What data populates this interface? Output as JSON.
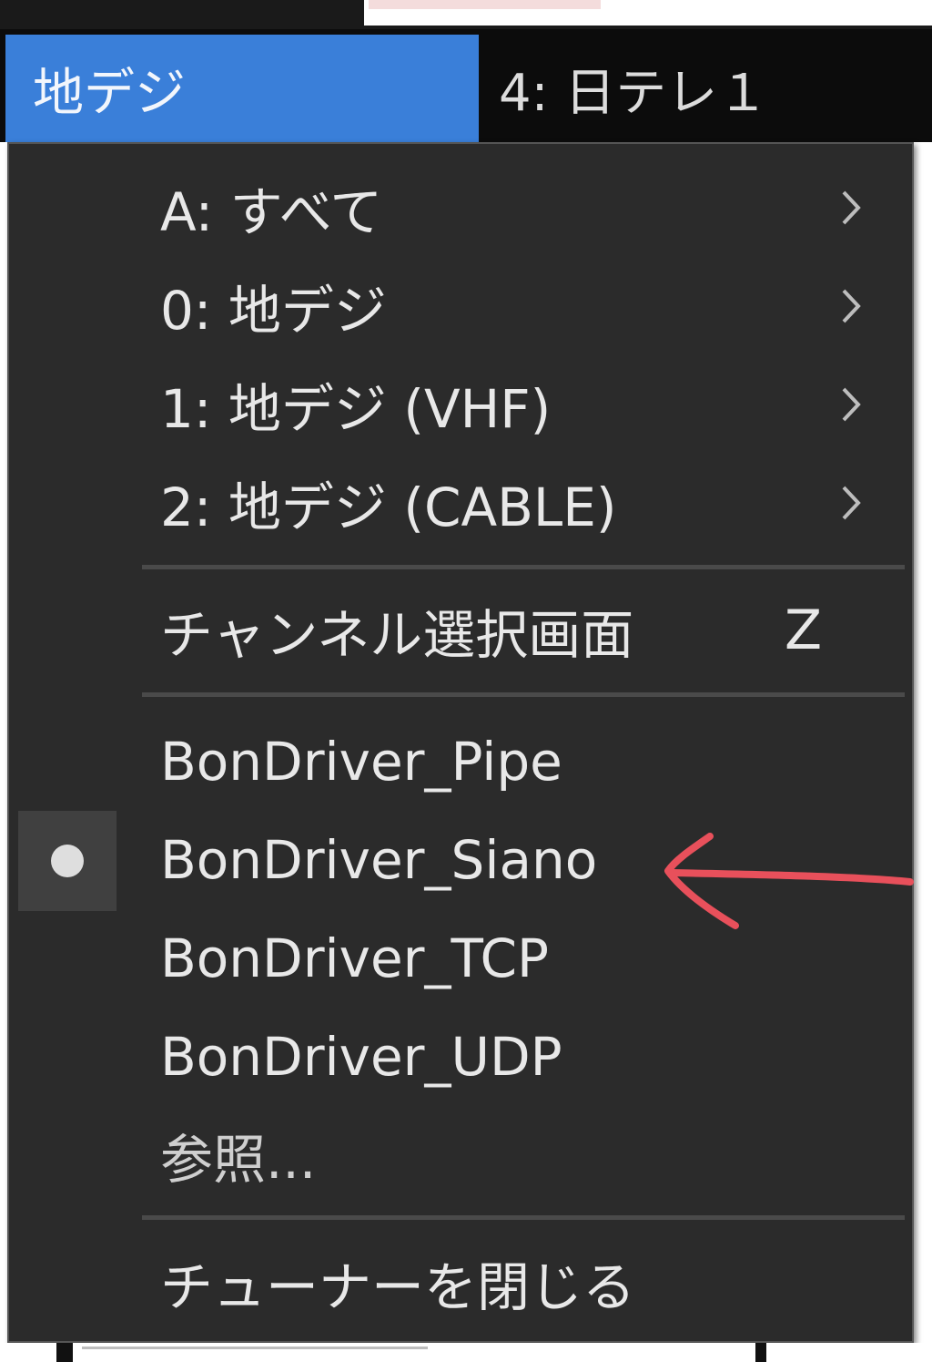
{
  "menubar": {
    "active_label": "地デジ",
    "channel_label": "4: 日テレ１"
  },
  "menu": {
    "spaces": [
      {
        "label": "A: すべて"
      },
      {
        "label": "0: 地デジ"
      },
      {
        "label": "1: 地デジ (VHF)"
      },
      {
        "label": "2: 地デジ (CABLE)"
      }
    ],
    "channel_select": {
      "label": "チャンネル選択画面",
      "shortcut": "Z"
    },
    "drivers": [
      {
        "label": "BonDriver_Pipe",
        "checked": false
      },
      {
        "label": "BonDriver_Siano",
        "checked": true
      },
      {
        "label": "BonDriver_TCP",
        "checked": false
      },
      {
        "label": "BonDriver_UDP",
        "checked": false
      }
    ],
    "browse": {
      "label": "参照..."
    },
    "close_tuner": {
      "label": "チューナーを閉じる"
    }
  },
  "colors": {
    "menu_bg": "#2b2b2b",
    "active_blue": "#3a7fd9",
    "annotation_red": "#e8505b",
    "text": "#e8e8e8"
  },
  "icons": {
    "submenu": "chevron-right-icon",
    "selected": "radio-dot-icon",
    "annotation": "red-arrow-icon"
  }
}
